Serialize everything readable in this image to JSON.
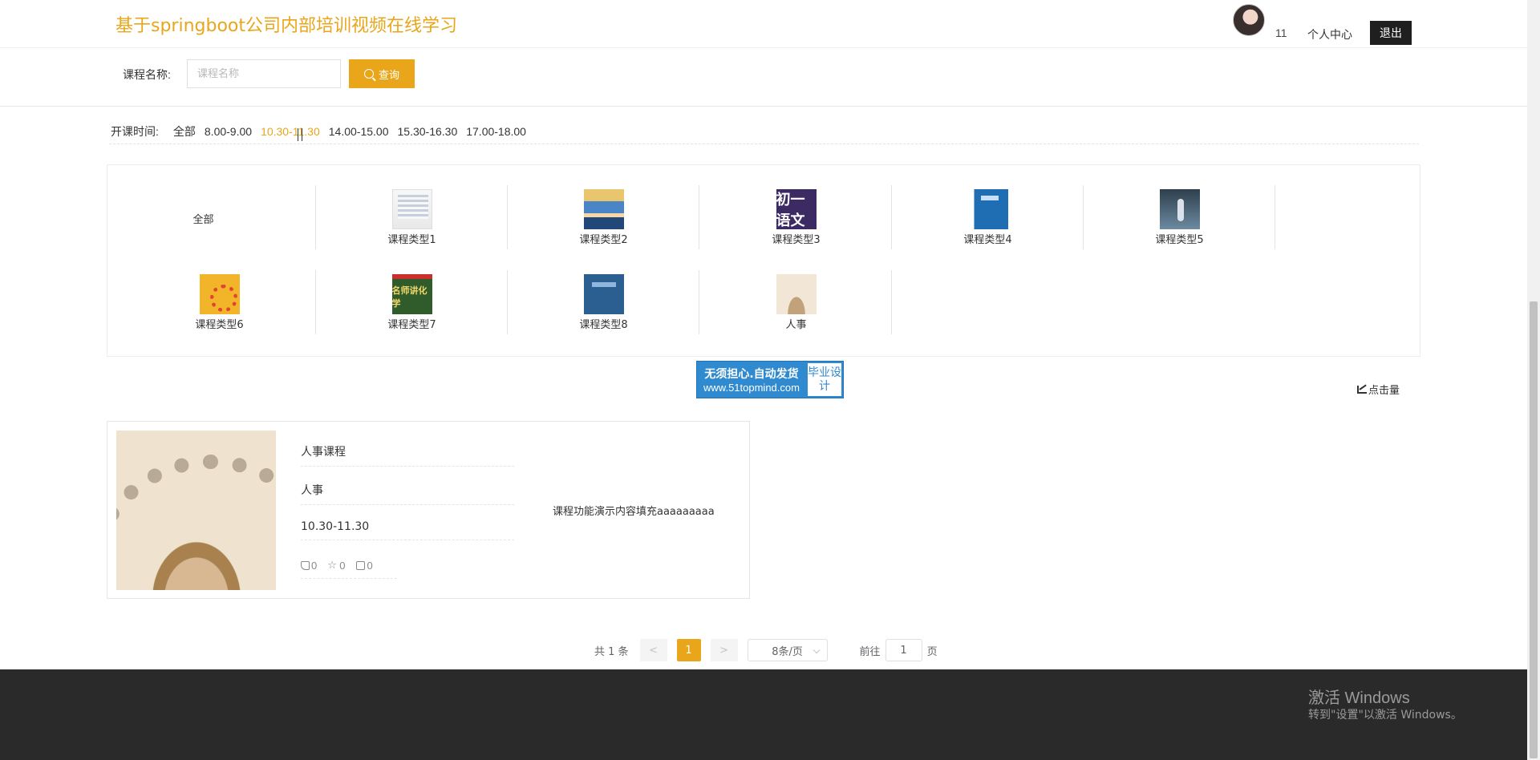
{
  "header": {
    "title": "基于springboot公司内部培训视频在线学习",
    "username": "11",
    "center_link": "个人中心",
    "logout": "退出"
  },
  "search": {
    "label": "课程名称:",
    "placeholder": "课程名称",
    "button": "查询"
  },
  "time_filter": {
    "label": "开课时间:",
    "options": [
      "全部",
      "8.00-9.00",
      "10.30-11.30",
      "14.00-15.00",
      "15.30-16.30",
      "17.00-18.00"
    ],
    "active_index": 2
  },
  "categories": [
    {
      "label": "全部",
      "icon": "all"
    },
    {
      "label": "课程类型1",
      "icon": "category-1-thumb"
    },
    {
      "label": "课程类型2",
      "icon": "category-2-thumb"
    },
    {
      "label": "课程类型3",
      "icon": "category-3-thumb",
      "thumb_text": "初一语文"
    },
    {
      "label": "课程类型4",
      "icon": "category-4-thumb"
    },
    {
      "label": "课程类型5",
      "icon": "category-5-thumb"
    },
    {
      "label": "课程类型6",
      "icon": "category-6-thumb"
    },
    {
      "label": "课程类型7",
      "icon": "category-7-thumb",
      "thumb_text": "名师讲化学"
    },
    {
      "label": "课程类型8",
      "icon": "category-8-thumb"
    },
    {
      "label": "人事",
      "icon": "category-hr-thumb"
    }
  ],
  "banner": {
    "line1": "无须担心.自动发货",
    "line2": "www.51topmind.com",
    "right": "毕业设计"
  },
  "sort": {
    "label": "点击量"
  },
  "course": {
    "name": "人事课程",
    "category": "人事",
    "time": "10.30-11.30",
    "likes": "0",
    "favorites": "0",
    "comments": "0",
    "description": "课程功能演示内容填充aaaaaaaaa"
  },
  "pagination": {
    "total": "共 1 条",
    "prev": "<",
    "page": "1",
    "next": ">",
    "page_size": "8条/页",
    "goto_label": "前往",
    "goto_value": "1",
    "page_suffix": "页"
  },
  "watermark": {
    "line1": "激活 Windows",
    "line2": "转到\"设置\"以激活 Windows。"
  },
  "colors": {
    "accent": "#e9a61a",
    "footer": "#2a2a2a"
  }
}
